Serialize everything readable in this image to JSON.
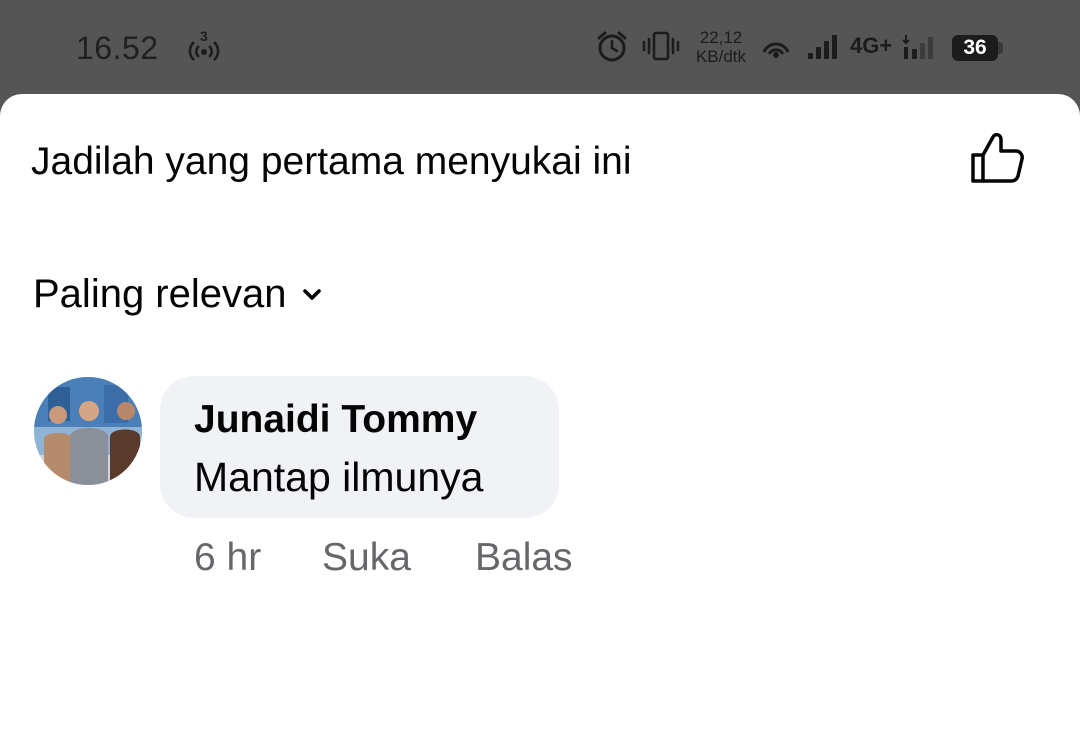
{
  "status_bar": {
    "time": "16.52",
    "hotspot_count": "3",
    "speed_value": "22,12",
    "speed_unit": "KB/dtk",
    "network": "4G+",
    "battery": "36",
    "icons": [
      "hotspot-icon",
      "alarm-icon",
      "vibrate-icon",
      "wifi-icon",
      "signal-icon",
      "signal-weak-icon"
    ]
  },
  "reactions": {
    "summary": "Jadilah yang pertama menyukai ini",
    "like_icon": "thumbs-up-outline-icon"
  },
  "sort": {
    "label": "Paling relevan",
    "icon": "chevron-down-icon"
  },
  "comments": [
    {
      "author": "Junaidi Tommy",
      "text": "Mantap ilmunya",
      "time": "6 hr",
      "like_label": "Suka",
      "reply_label": "Balas"
    }
  ],
  "colors": {
    "status_bar_bg": "#555555",
    "sheet_bg": "#ffffff",
    "bubble_bg": "#f0f2f5",
    "secondary_text": "#65676b",
    "primary_text": "#050505"
  }
}
